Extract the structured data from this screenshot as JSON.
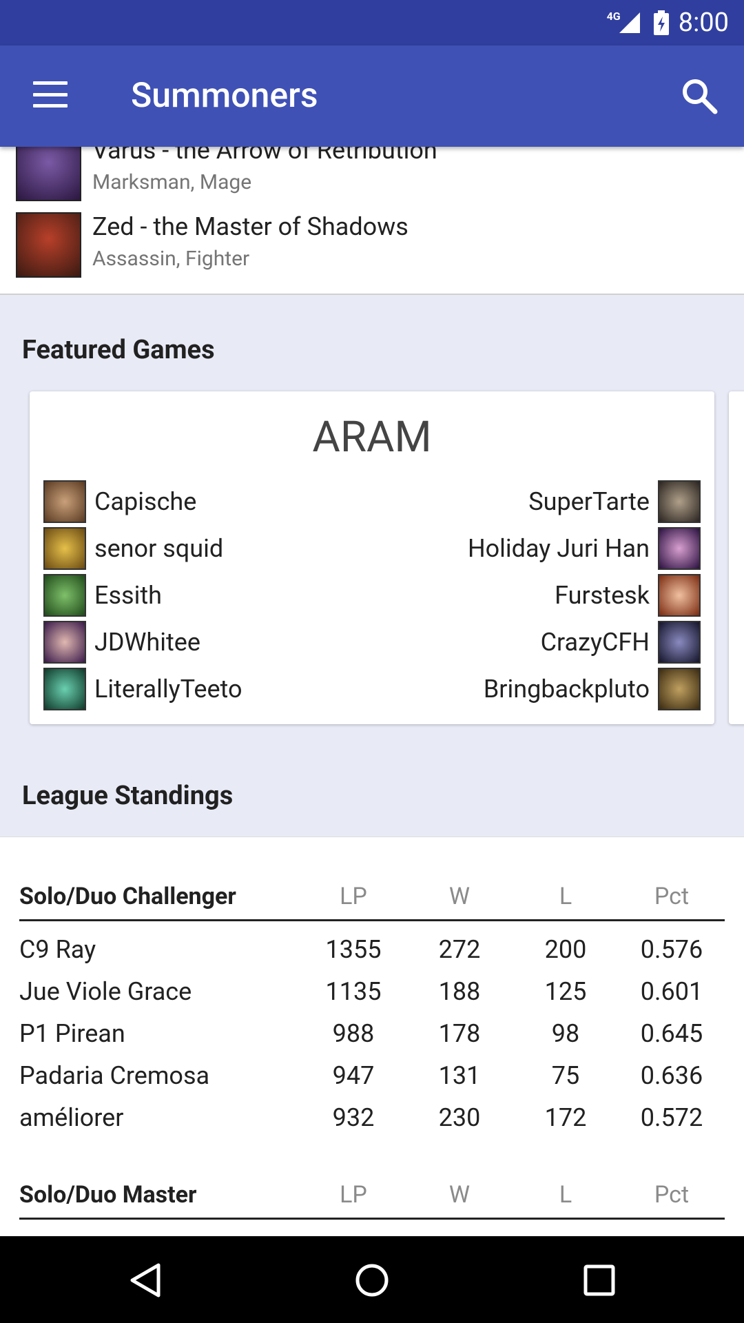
{
  "status_bar": {
    "network": "4G",
    "time": "8:00"
  },
  "app_bar": {
    "title": "Summoners"
  },
  "champions": [
    {
      "name": "Varus - the Arrow of Retribution",
      "roles": "Marksman, Mage",
      "color_a": "#7b5aa6",
      "color_b": "#2b1740"
    },
    {
      "name": "Zed - the Master of Shadows",
      "roles": "Assassin, Fighter",
      "color_a": "#b8402a",
      "color_b": "#3a1a12"
    }
  ],
  "featured_games": {
    "title": "Featured Games",
    "mode": "ARAM",
    "left_team": [
      {
        "name": "Capische",
        "color": "#a07b5a"
      },
      {
        "name": "senor squid",
        "color": "#d2a23a"
      },
      {
        "name": "Essith",
        "color": "#5b9a4b"
      },
      {
        "name": "JDWhitee",
        "color": "#6a3f7a"
      },
      {
        "name": "LiterallyTeeto",
        "color": "#3aa38a"
      }
    ],
    "right_team": [
      {
        "name": "SuperTarte",
        "color": "#8c7a66"
      },
      {
        "name": "Holiday Juri Han",
        "color": "#7a4e9c"
      },
      {
        "name": "Furstesk",
        "color": "#c2552b"
      },
      {
        "name": "CrazyCFH",
        "color": "#4b4a7a"
      },
      {
        "name": "Bringbackpluto",
        "color": "#8e6a3a"
      }
    ]
  },
  "league_standings": {
    "title": "League Standings",
    "columns": {
      "lp": "LP",
      "w": "W",
      "l": "L",
      "pct": "Pct"
    },
    "tables": [
      {
        "league": "Solo/Duo Challenger",
        "rows": [
          {
            "name": "C9 Ray",
            "lp": "1355",
            "w": "272",
            "l": "200",
            "pct": "0.576"
          },
          {
            "name": "Jue Viole Grace",
            "lp": "1135",
            "w": "188",
            "l": "125",
            "pct": "0.601"
          },
          {
            "name": "P1 Pirean",
            "lp": "988",
            "w": "178",
            "l": "98",
            "pct": "0.645"
          },
          {
            "name": "Padaria Cremosa",
            "lp": "947",
            "w": "131",
            "l": "75",
            "pct": "0.636"
          },
          {
            "name": "améliorer",
            "lp": "932",
            "w": "230",
            "l": "172",
            "pct": "0.572"
          }
        ]
      },
      {
        "league": "Solo/Duo Master",
        "rows": []
      }
    ]
  },
  "colors": {
    "status_bar": "#303f9f",
    "app_bar": "#3f51b5",
    "background": "#e8eaf6"
  }
}
